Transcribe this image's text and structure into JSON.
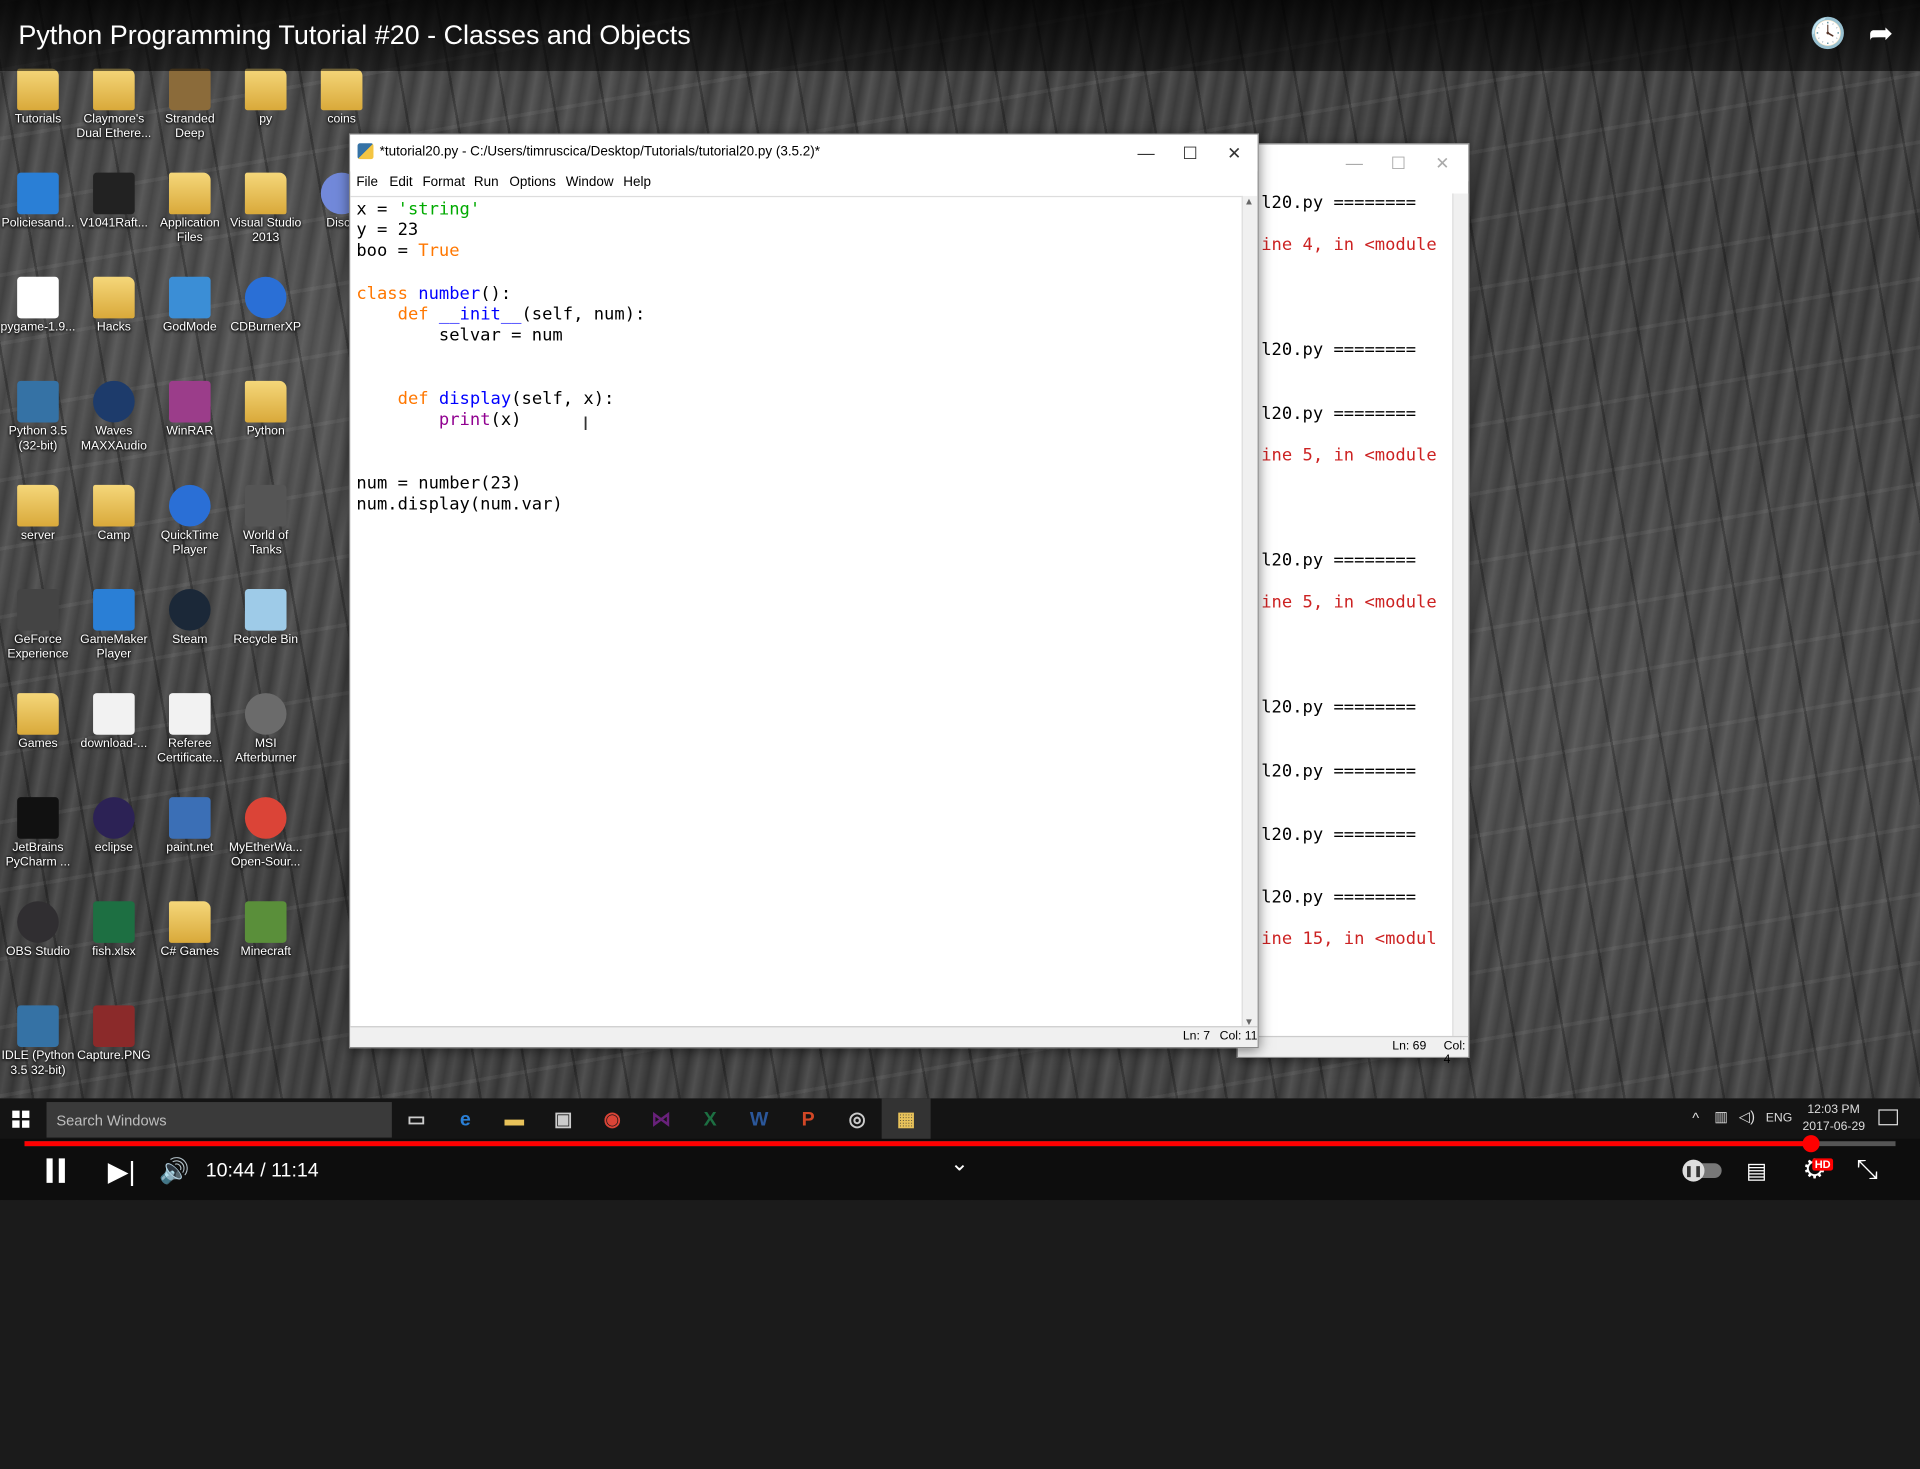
{
  "video": {
    "title": "Python Programming Tutorial #20 - Classes and Objects",
    "current_time": "10:44",
    "duration": "11:14",
    "time_separator": "/",
    "progress": 0.955,
    "accent": "#ff0000",
    "quality_badge": "HD"
  },
  "desktop_icons": [
    {
      "label": "Tutorials",
      "icon": "folder-icon",
      "color": "#e8c25a"
    },
    {
      "label": "Claymore's Dual Ethere...",
      "icon": "folder-icon",
      "color": "#e8c25a"
    },
    {
      "label": "Stranded Deep",
      "icon": "game-icon",
      "color": "#8b6b3a"
    },
    {
      "label": "py",
      "icon": "folder-icon",
      "color": "#e8c25a"
    },
    {
      "label": "coins",
      "icon": "folder-icon",
      "color": "#e8c25a"
    },
    {
      "label": "Policiesand...",
      "icon": "pdf-icon",
      "color": "#2a7fd6"
    },
    {
      "label": "V1041Raft...",
      "icon": "file-icon",
      "color": "#222222"
    },
    {
      "label": "Application Files",
      "icon": "folder-icon",
      "color": "#e8c25a"
    },
    {
      "label": "Visual Studio 2013",
      "icon": "folder-icon",
      "color": "#e8c25a"
    },
    {
      "label": "Disco",
      "icon": "discord-icon",
      "color": "#7289da"
    },
    {
      "label": "pygame-1.9...",
      "icon": "file-icon",
      "color": "#ffffff"
    },
    {
      "label": "Hacks",
      "icon": "folder-icon",
      "color": "#e8c25a"
    },
    {
      "label": "GodMode",
      "icon": "control-panel-icon",
      "color": "#3b8ed6"
    },
    {
      "label": "CDBurnerXP",
      "icon": "disc-icon",
      "color": "#2a6fd6"
    },
    {
      "label": "Python 3.5 (32-bit)",
      "icon": "python-icon",
      "color": "#3572a5"
    },
    {
      "label": "Waves MAXXAudio",
      "icon": "audio-icon",
      "color": "#1d3b6b"
    },
    {
      "label": "WinRAR",
      "icon": "archive-icon",
      "color": "#9b3d8a"
    },
    {
      "label": "Python",
      "icon": "folder-icon",
      "color": "#e8c25a"
    },
    {
      "label": "server",
      "icon": "folder-icon",
      "color": "#e8c25a"
    },
    {
      "label": "Camp",
      "icon": "folder-icon",
      "color": "#e8c25a"
    },
    {
      "label": "QuickTime Player",
      "icon": "quicktime-icon",
      "color": "#2a6fd6"
    },
    {
      "label": "World of Tanks",
      "icon": "tank-icon",
      "color": "#555555"
    },
    {
      "label": "GeForce Experience",
      "icon": "nvidia-icon",
      "color": "#444444"
    },
    {
      "label": "GameMaker Player",
      "icon": "gamemaker-icon",
      "color": "#2a7fd6"
    },
    {
      "label": "Steam",
      "icon": "steam-icon",
      "color": "#1b2838"
    },
    {
      "label": "Recycle Bin",
      "icon": "recycle-bin-icon",
      "color": "#9ecbe8"
    },
    {
      "label": "Games",
      "icon": "folder-icon",
      "color": "#e8c25a"
    },
    {
      "label": "download-...",
      "icon": "image-icon",
      "color": "#f2f2f2"
    },
    {
      "label": "Referee Certificate...",
      "icon": "certificate-icon",
      "color": "#f2f2f2"
    },
    {
      "label": "MSI Afterburner",
      "icon": "afterburner-icon",
      "color": "#6b6b6b"
    },
    {
      "label": "JetBrains PyCharm ...",
      "icon": "pycharm-icon",
      "color": "#111111"
    },
    {
      "label": "eclipse",
      "icon": "eclipse-icon",
      "color": "#2c2255"
    },
    {
      "label": "paint.net",
      "icon": "paint-icon",
      "color": "#3b6fb6"
    },
    {
      "label": "MyEtherWa... Open-Sour...",
      "icon": "chrome-icon",
      "color": "#db4437"
    },
    {
      "label": "OBS Studio",
      "icon": "obs-icon",
      "color": "#302e31"
    },
    {
      "label": "fish.xlsx",
      "icon": "excel-icon",
      "color": "#1d6f42"
    },
    {
      "label": "C# Games",
      "icon": "folder-icon",
      "color": "#e8c25a"
    },
    {
      "label": "Minecraft",
      "icon": "minecraft-icon",
      "color": "#5a8f3a"
    },
    {
      "label": "IDLE (Python 3.5 32-bit)",
      "icon": "idle-icon",
      "color": "#3572a5"
    },
    {
      "label": "Capture.PNG",
      "icon": "image-icon",
      "color": "#8b2a2a"
    }
  ],
  "editor_window": {
    "title": "*tutorial20.py - C:/Users/timruscica/Desktop/Tutorials/tutorial20.py (3.5.2)*",
    "menu": [
      "File",
      "Edit",
      "Format",
      "Run",
      "Options",
      "Window",
      "Help"
    ],
    "status_line": "Ln: 7",
    "status_col": "Col: 11",
    "code": [
      [
        {
          "t": "x = "
        },
        {
          "t": "'string'",
          "c": "str"
        }
      ],
      [
        {
          "t": "y = 23"
        }
      ],
      [
        {
          "t": "boo = "
        },
        {
          "t": "True",
          "c": "kw"
        }
      ],
      [
        {
          "t": ""
        }
      ],
      [
        {
          "t": "class ",
          "c": "kw"
        },
        {
          "t": "number",
          "c": "fn"
        },
        {
          "t": "():"
        }
      ],
      [
        {
          "t": "    "
        },
        {
          "t": "def ",
          "c": "kw"
        },
        {
          "t": "__init__",
          "c": "fn"
        },
        {
          "t": "(self, num):"
        }
      ],
      [
        {
          "t": "        selvar = num"
        }
      ],
      [
        {
          "t": ""
        }
      ],
      [
        {
          "t": ""
        }
      ],
      [
        {
          "t": "    "
        },
        {
          "t": "def ",
          "c": "kw"
        },
        {
          "t": "display",
          "c": "fn"
        },
        {
          "t": "(self, x):"
        }
      ],
      [
        {
          "t": "        "
        },
        {
          "t": "print",
          "c": "bi"
        },
        {
          "t": "(x)"
        }
      ],
      [
        {
          "t": ""
        }
      ],
      [
        {
          "t": ""
        }
      ],
      [
        {
          "t": "num = number(23)"
        }
      ],
      [
        {
          "t": "num.display(num.var)"
        }
      ]
    ]
  },
  "shell_window": {
    "status_line": "Ln: 69",
    "status_col": "Col: 4",
    "lines": [
      {
        "text": "l20.py ========",
        "color": "#000000"
      },
      {
        "text": "ine 4, in <module",
        "color": "#cc2222"
      },
      {
        "text": "l20.py ========",
        "color": "#000000"
      },
      {
        "text": "l20.py ========",
        "color": "#000000"
      },
      {
        "text": "ine 5, in <module",
        "color": "#cc2222"
      },
      {
        "text": "l20.py ========",
        "color": "#000000"
      },
      {
        "text": "ine 5, in <module",
        "color": "#cc2222"
      },
      {
        "text": "l20.py ========",
        "color": "#000000"
      },
      {
        "text": "l20.py ========",
        "color": "#000000"
      },
      {
        "text": "l20.py ========",
        "color": "#000000"
      },
      {
        "text": "l20.py ========",
        "color": "#000000"
      },
      {
        "text": "ine 15, in <modul",
        "color": "#cc2222"
      }
    ]
  },
  "taskbar": {
    "search_placeholder": "Search Windows",
    "apps": [
      {
        "name": "task-view-icon",
        "glyph": "▭",
        "color": "#cccccc"
      },
      {
        "name": "edge-icon",
        "glyph": "e",
        "color": "#2a7fd6"
      },
      {
        "name": "file-explorer-icon",
        "glyph": "▬",
        "color": "#e8c25a"
      },
      {
        "name": "store-icon",
        "glyph": "▣",
        "color": "#cccccc"
      },
      {
        "name": "chrome-icon",
        "glyph": "◉",
        "color": "#db4437"
      },
      {
        "name": "visual-studio-icon",
        "glyph": "⋈",
        "color": "#68217a"
      },
      {
        "name": "excel-icon",
        "glyph": "X",
        "color": "#1d6f42"
      },
      {
        "name": "word-icon",
        "glyph": "W",
        "color": "#2b579a"
      },
      {
        "name": "powerpoint-icon",
        "glyph": "P",
        "color": "#d24726"
      },
      {
        "name": "obs-icon",
        "glyph": "◎",
        "color": "#cccccc"
      },
      {
        "name": "idle-icon",
        "glyph": "▦",
        "color": "#e8c25a"
      }
    ],
    "language": "ENG",
    "time": "12:03 PM",
    "date": "2017-06-29"
  }
}
